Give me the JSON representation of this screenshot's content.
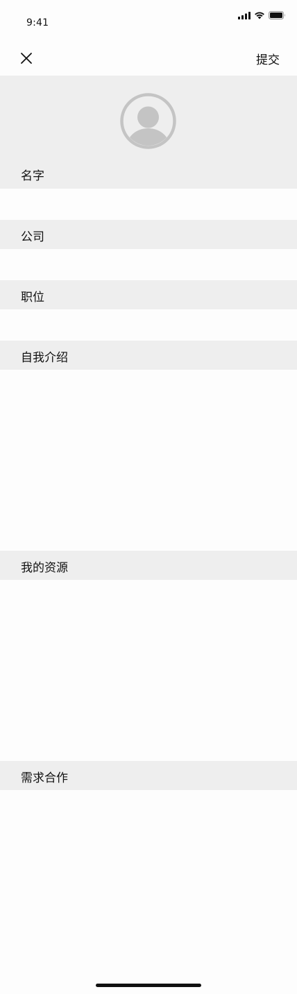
{
  "status_bar": {
    "time": "9:41",
    "icons": [
      "cellular-signal-icon",
      "wifi-icon",
      "battery-icon"
    ]
  },
  "nav": {
    "close_icon": "close-icon",
    "submit_label": "提交"
  },
  "avatar": {
    "icon": "user-avatar-icon"
  },
  "fields": {
    "name_label": "名字",
    "company_label": "公司",
    "position_label": "职位",
    "intro_label": "自我介绍",
    "resources_label": "我的资源",
    "needs_label": "需求合作"
  },
  "colors": {
    "section_bg": "#eeeeee",
    "page_bg": "#fdfdfd",
    "avatar_gray": "#c4c4c4"
  }
}
